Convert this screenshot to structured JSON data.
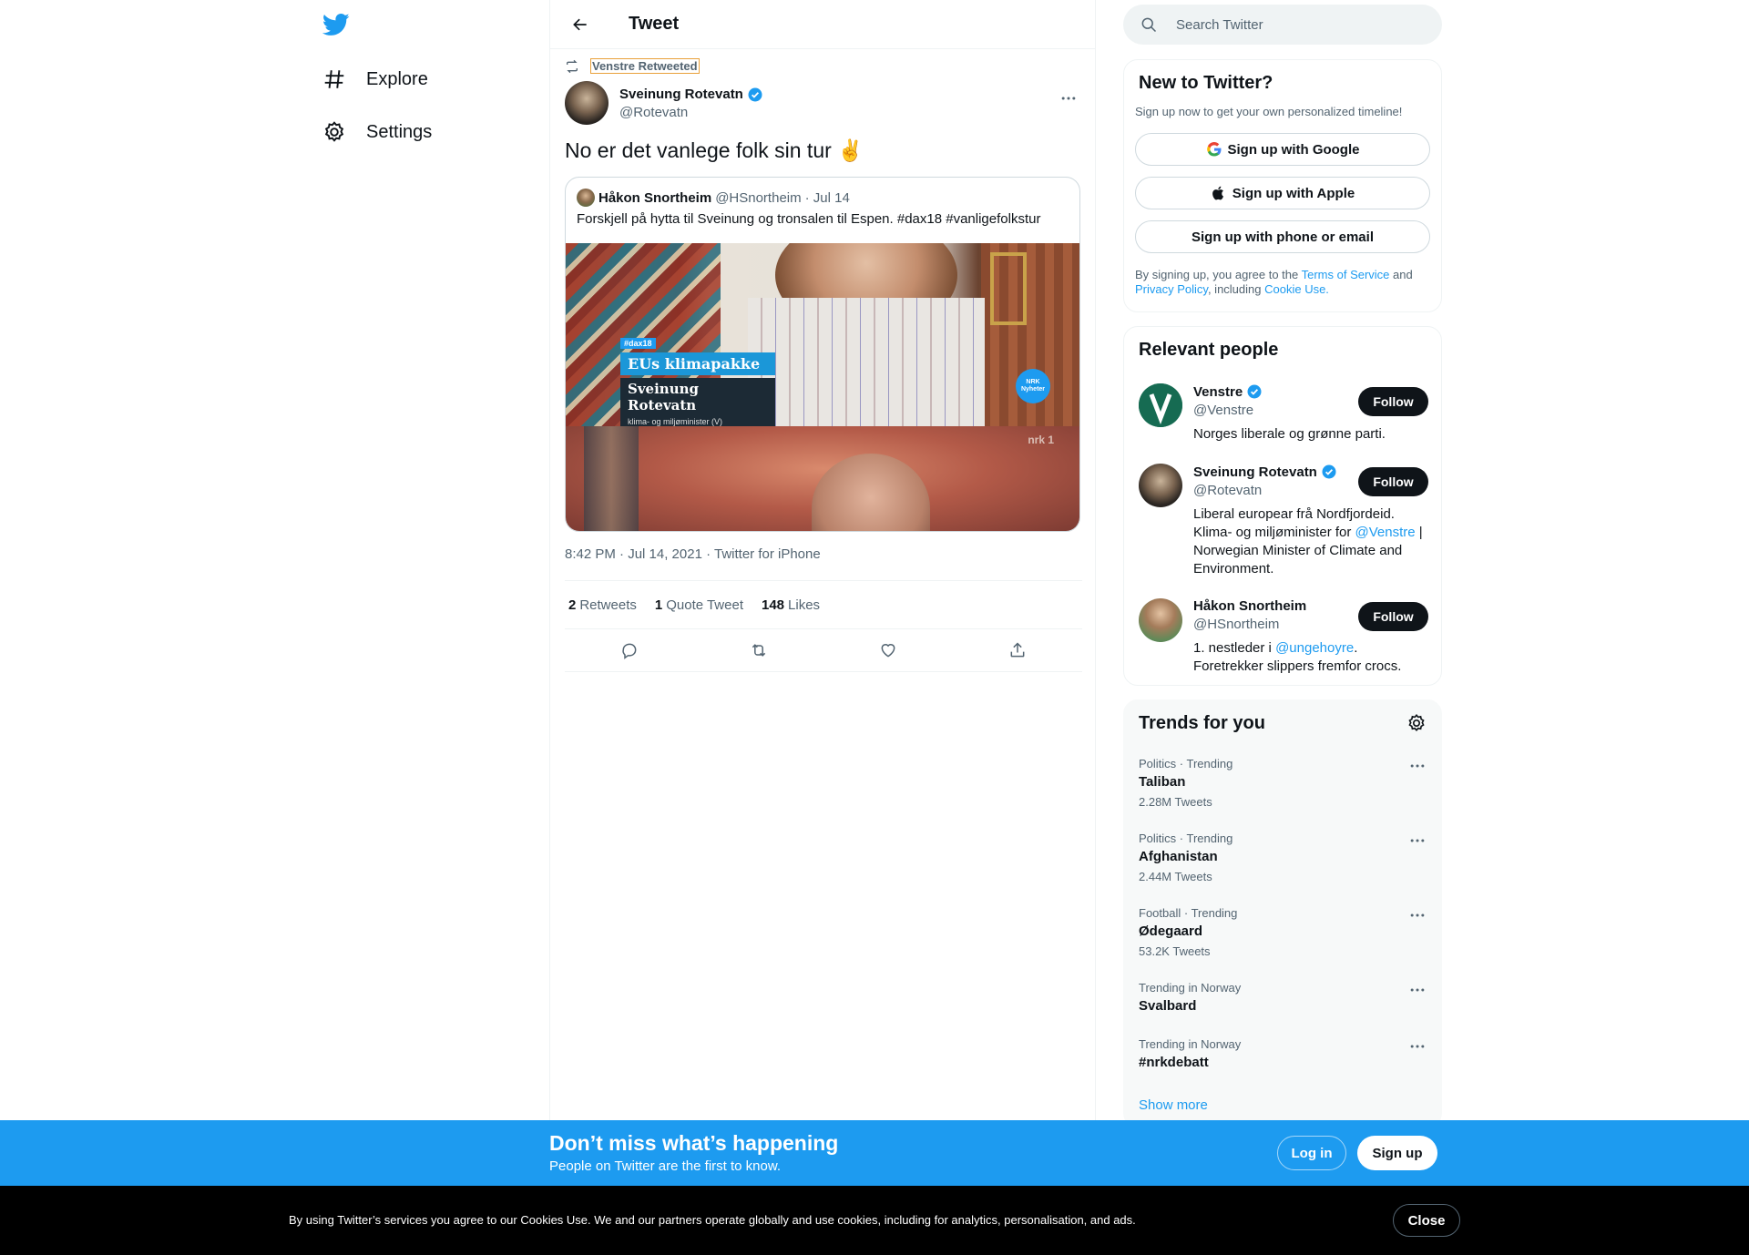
{
  "nav": {
    "logo": "twitter-bird-icon",
    "items": [
      {
        "label": "Explore",
        "icon": "hashtag-icon"
      },
      {
        "label": "Settings",
        "icon": "gear-icon"
      }
    ]
  },
  "header": {
    "title": "Tweet"
  },
  "tweet": {
    "retweeted_by": "Venstre Retweeted",
    "author_name": "Sveinung Rotevatn",
    "author_handle": "@Rotevatn",
    "text": "No er det vanlege folk sin tur ✌️",
    "quote": {
      "name": "Håkon Snortheim",
      "handle": "@HSnortheim",
      "date": "· Jul 14",
      "text": "Forskjell på hytta til Sveinung og tronsalen til Espen. #dax18 #vanligefolkstur",
      "media": {
        "tag": "#dax18",
        "title": "EUs klimapakke",
        "name": "Sveinung Rotevatn",
        "subtitle": "klima- og miljøminister (V)",
        "badge": "NRK Nyheter",
        "channel": "nrk 1"
      }
    },
    "meta": "8:42 PM · Jul 14, 2021 · Twitter for iPhone",
    "stats": {
      "retweets_count": "2",
      "retweets_label": "Retweets",
      "quotes_count": "1",
      "quotes_label": "Quote Tweet",
      "likes_count": "148",
      "likes_label": "Likes"
    }
  },
  "search": {
    "placeholder": "Search Twitter"
  },
  "new_to_twitter": {
    "title": "New to Twitter?",
    "subtitle": "Sign up now to get your own personalized timeline!",
    "google": "Sign up with Google",
    "apple": "Sign up with Apple",
    "phone": "Sign up with phone or email",
    "legal_1": "By signing up, you agree to the ",
    "terms": "Terms of Service",
    "legal_2": " and ",
    "privacy": "Privacy Policy",
    "legal_3": ", including ",
    "cookie": "Cookie Use."
  },
  "relevant_people": {
    "title": "Relevant people",
    "follow_label": "Follow",
    "people": [
      {
        "name": "Venstre",
        "handle": "@Venstre",
        "bio": "Norges liberale og grønne parti."
      },
      {
        "name": "Sveinung Rotevatn",
        "handle": "@Rotevatn",
        "bio_1": "Liberal europear frå Nordfjordeid. Klima- og miljøminister for ",
        "mention": "@Venstre",
        "bio_2": " | Norwegian Minister of Climate and Environment."
      },
      {
        "name": "Håkon Snortheim",
        "handle": "@HSnortheim",
        "bio_1": "1. nestleder i ",
        "mention": "@ungehoyre",
        "bio_2": ". Foretrekker slippers fremfor crocs."
      }
    ]
  },
  "trends": {
    "title": "Trends for you",
    "items": [
      {
        "context": "Politics · Trending",
        "name": "Taliban",
        "count": "2.28M Tweets"
      },
      {
        "context": "Politics · Trending",
        "name": "Afghanistan",
        "count": "2.44M Tweets"
      },
      {
        "context": "Football · Trending",
        "name": "Ødegaard",
        "count": "53.2K Tweets"
      },
      {
        "context": "Trending in Norway",
        "name": "Svalbard",
        "count": ""
      },
      {
        "context": "Trending in Norway",
        "name": "#nrkdebatt",
        "count": ""
      }
    ],
    "show_more": "Show more"
  },
  "banner": {
    "title": "Don’t miss what’s happening",
    "subtitle": "People on Twitter are the first to know.",
    "login": "Log in",
    "signup": "Sign up"
  },
  "cookie_bar": {
    "text": "By using Twitter’s services you agree to our Cookies Use. We and our partners operate globally and use cookies, including for analytics, personalisation, and ads.",
    "close": "Close"
  },
  "colors": {
    "accent": "#1d9bf0",
    "text": "#0f1419",
    "secondary": "#536471",
    "border": "#eff3f4"
  }
}
